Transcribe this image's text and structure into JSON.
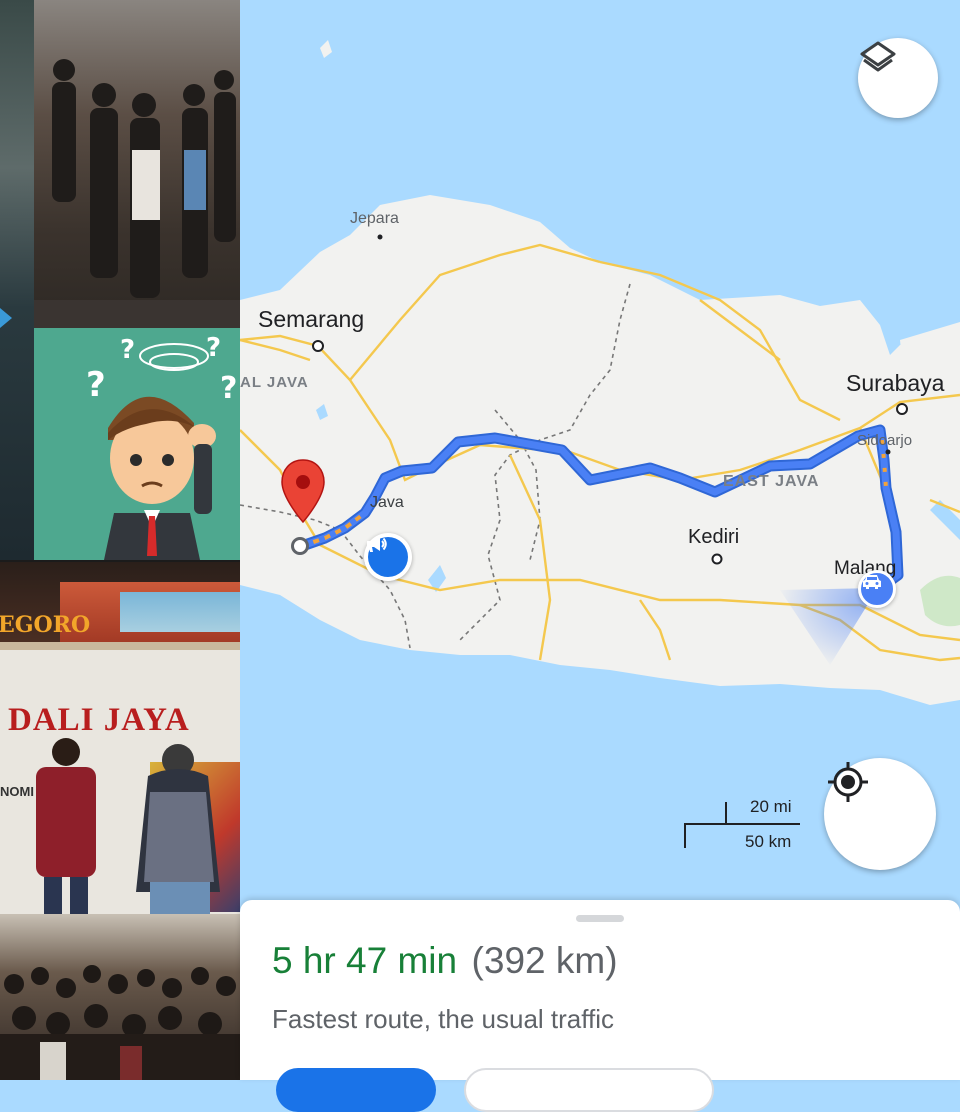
{
  "collage": {
    "bus_text_1": "EGORO",
    "bus_text_2": "DALI JAYA",
    "bus_text_3": "NOMI"
  },
  "map": {
    "places": {
      "jepara": "Jepara",
      "semarang": "Semarang",
      "central_java": "AL JAVA",
      "java": "Java",
      "surabaya": "Surabaya",
      "sidoarjo": "Sidoarjo",
      "east_java": "EAST JAVA",
      "kediri": "Kediri",
      "malang": "Malang"
    },
    "scale": {
      "imperial": "20 mi",
      "metric": "50 km"
    },
    "layers_icon": "layers-icon",
    "location_icon": "my-location-icon",
    "alert_icon": "traffic-report-icon",
    "colors": {
      "route": "#4a80f5",
      "land": "#f2f2f0",
      "water": "#aadaff",
      "road": "#f4c84e",
      "pin": "#ea4335",
      "eta_green": "#188038"
    }
  },
  "route_sheet": {
    "duration": "5 hr 47 min",
    "distance": "(392 km)",
    "description": "Fastest route, the usual traffic"
  }
}
